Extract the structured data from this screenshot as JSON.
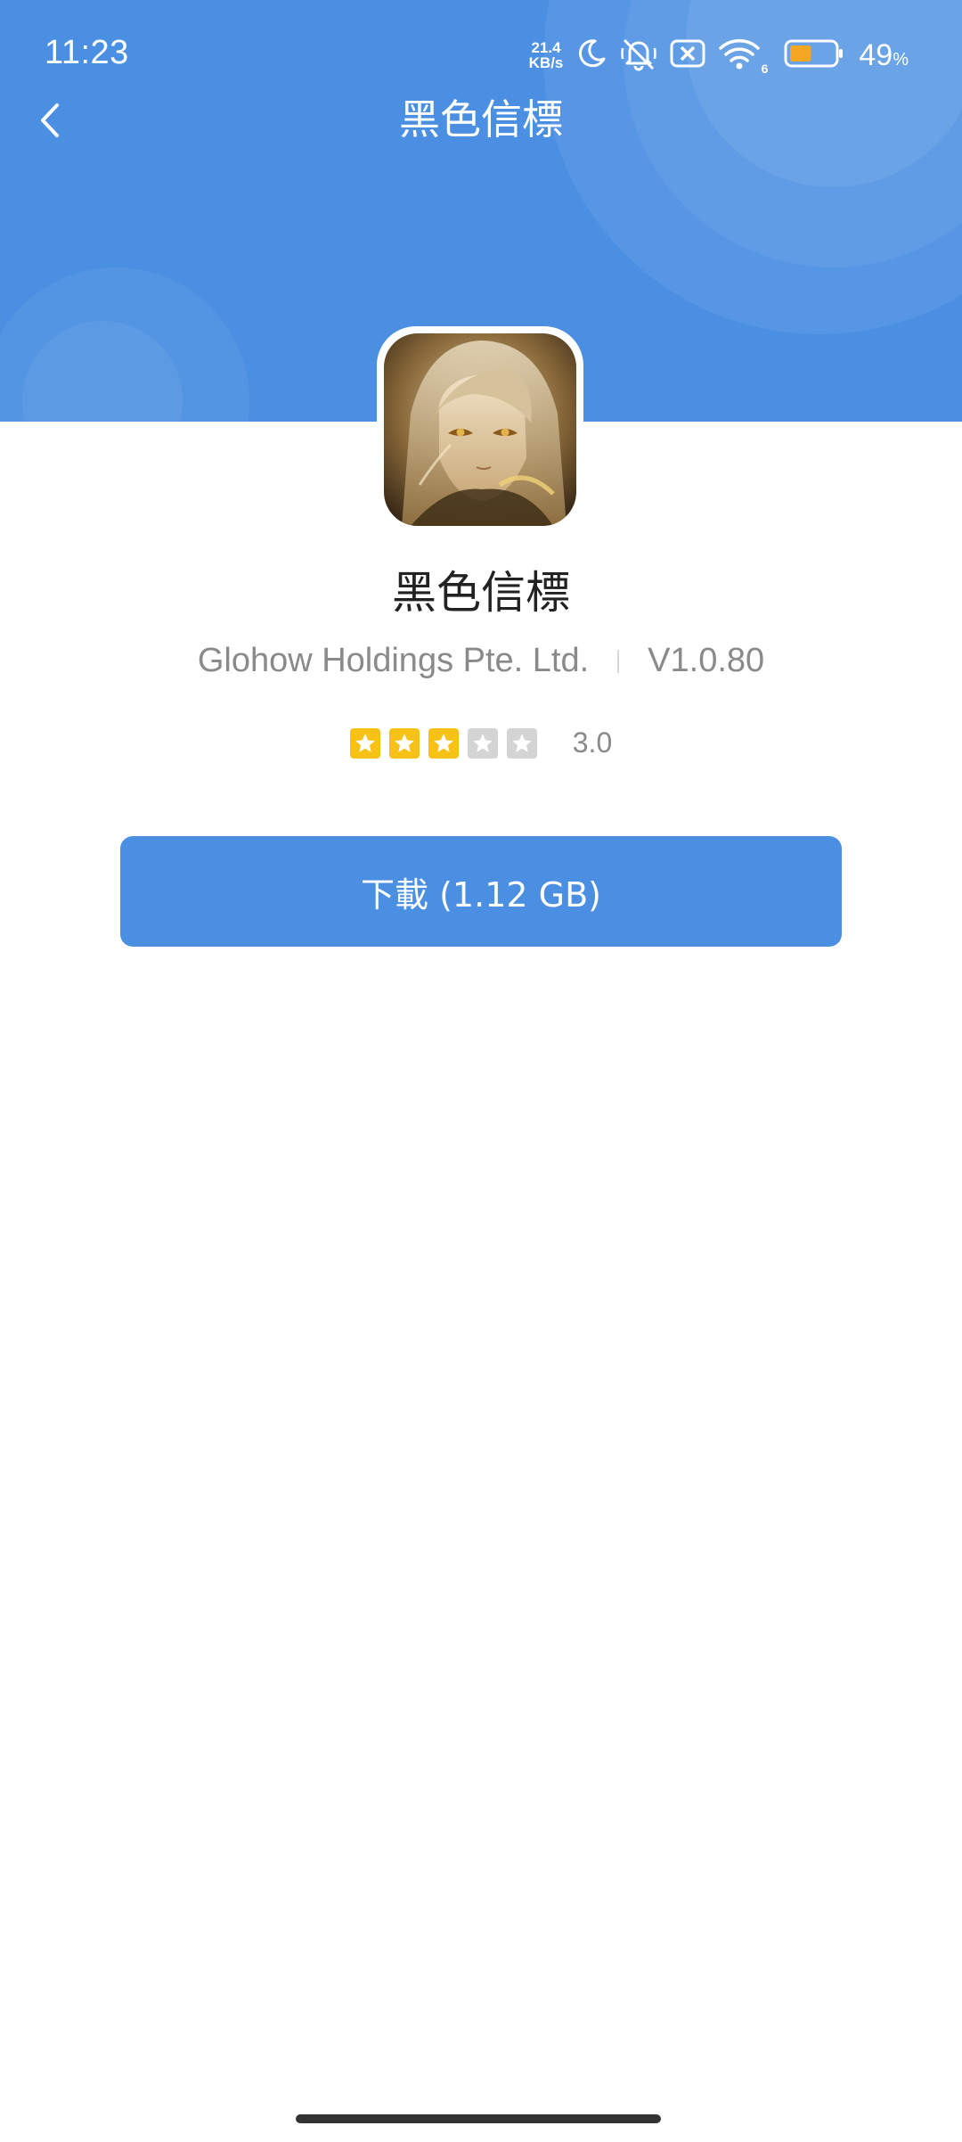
{
  "status_bar": {
    "time": "11:23",
    "net_speed_value": "21.4",
    "net_speed_unit": "KB/s",
    "wifi_label": "6",
    "battery_percent": "49",
    "battery_unit": "%",
    "icons": [
      "moon-icon",
      "mute-icon",
      "sim-off-icon",
      "wifi-icon",
      "battery-icon"
    ],
    "battery_level": 0.49
  },
  "nav": {
    "title": "黑色信標",
    "back_icon": "chevron-left-icon"
  },
  "app": {
    "name": "黑色信標",
    "developer": "Glohow Holdings Pte. Ltd.",
    "version": "V1.0.80",
    "rating": 3,
    "rating_max": 5,
    "rating_text": "3.0"
  },
  "download": {
    "label": "下載 (1.12 GB)"
  },
  "colors": {
    "primary": "#4a8fe2",
    "star_on": "#f7c215",
    "star_off": "#d4d4d4"
  }
}
